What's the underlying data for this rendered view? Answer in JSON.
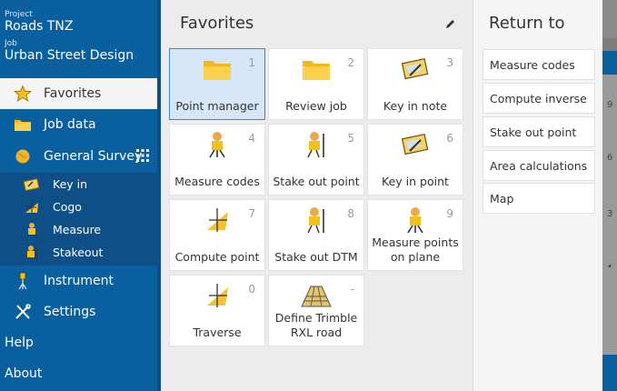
{
  "sidebar": {
    "project_label": "Project",
    "project_name": "Roads TNZ",
    "job_label": "Job",
    "job_name": "Urban Street Design",
    "favorites": "Favorites",
    "job_data": "Job data",
    "general_survey": "General Survey",
    "sub_items": [
      "Key in",
      "Cogo",
      "Measure",
      "Stakeout"
    ],
    "instrument": "Instrument",
    "settings": "Settings",
    "help": "Help",
    "about": "About"
  },
  "favorites_panel": {
    "title": "Favorites",
    "tiles": [
      {
        "label": "Point manager",
        "num": "1",
        "icon": "folder-icon"
      },
      {
        "label": "Review job",
        "num": "2",
        "icon": "folder-icon"
      },
      {
        "label": "Key in note",
        "num": "3",
        "icon": "keyin-icon"
      },
      {
        "label": "Measure codes",
        "num": "4",
        "icon": "surveyor-icon"
      },
      {
        "label": "Stake out point",
        "num": "5",
        "icon": "stakeout-icon"
      },
      {
        "label": "Key in point",
        "num": "6",
        "icon": "keyin-icon"
      },
      {
        "label": "Compute point",
        "num": "7",
        "icon": "cogo-icon"
      },
      {
        "label": "Stake out DTM",
        "num": "8",
        "icon": "stakeout-icon"
      },
      {
        "label": "Measure points on plane",
        "num": "9",
        "icon": "surveyor-icon"
      },
      {
        "label": "Traverse",
        "num": "0",
        "icon": "cogo-icon"
      },
      {
        "label": "Define Trimble RXL road",
        "num": "-",
        "icon": "road-icon"
      }
    ]
  },
  "return_panel": {
    "title": "Return to",
    "items": [
      "Measure codes",
      "Compute inverse",
      "Stake out point",
      "Area calculations",
      "Map"
    ]
  },
  "edge": {
    "nums": [
      "9",
      "6",
      "3",
      "•"
    ]
  },
  "colors": {
    "sidebar": "#0a5f9e",
    "selected_tile": "#d4e6f7",
    "accent": "#3b86c6"
  }
}
